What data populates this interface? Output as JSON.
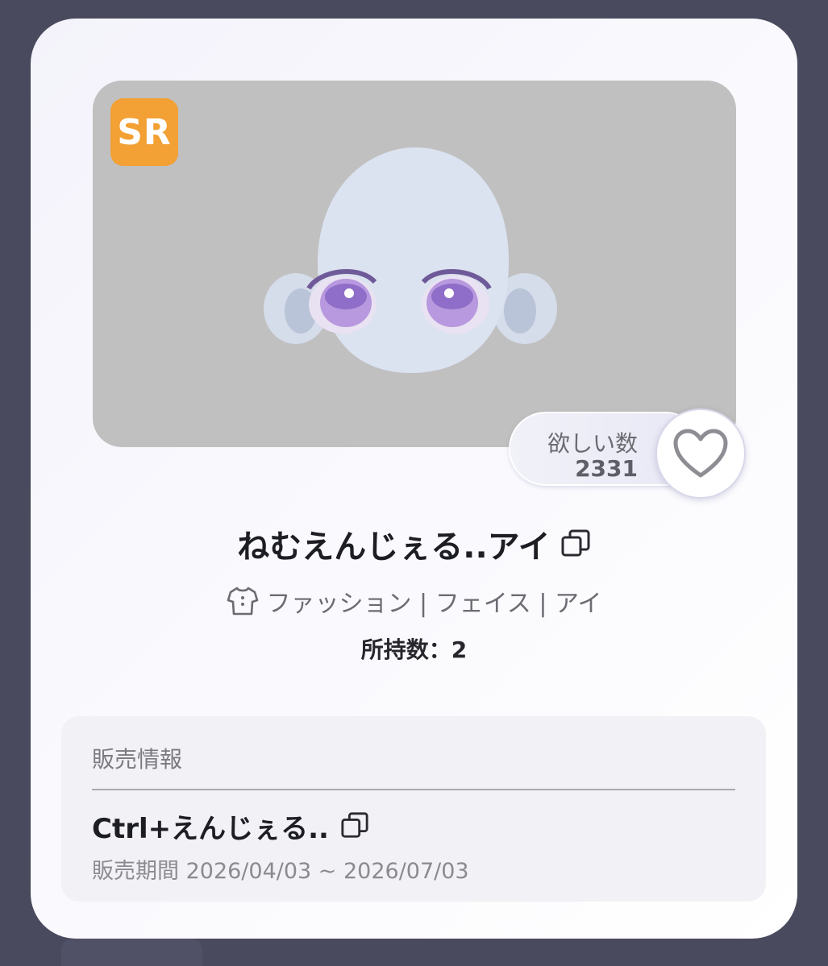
{
  "item": {
    "rarity": "SR",
    "title": "ねむえんじぇる..アイ",
    "category": "ファッション | フェイス | アイ",
    "owned_text": "所持数：2"
  },
  "want": {
    "label": "欲しい数",
    "count": "2331"
  },
  "sales": {
    "header": "販売情報",
    "shop_name": "Ctrl+えんじぇる..",
    "period": "販売期間 2026/04/03 ~ 2026/07/03"
  },
  "colors": {
    "rarity_badge": "#f3a034",
    "preview_bg": "#c0c0c0",
    "backdrop": "#4a4a5e"
  },
  "icons": {
    "copy": "copy-icon",
    "heart": "heart-outline-icon",
    "fashion": "shirt-icon"
  }
}
